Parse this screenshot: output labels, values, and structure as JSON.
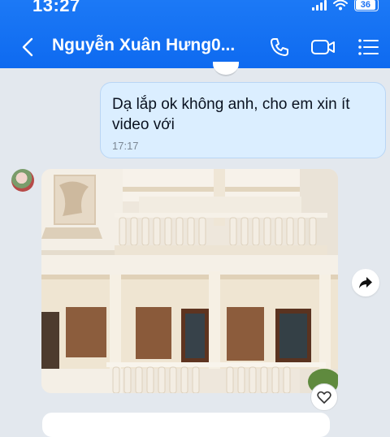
{
  "status_bar": {
    "time": "13:27",
    "battery_level": "36"
  },
  "header": {
    "contact_name": "Nguyễn Xuân Hưng0...",
    "accent_color": "#1473f5"
  },
  "messages": [
    {
      "text": "Dạ lắp ok không anh, cho em xin ít video với",
      "time": "17:17",
      "direction": "outgoing"
    }
  ],
  "icons": {
    "back": "chevron-left-icon",
    "call": "phone-icon",
    "video": "video-camera-icon",
    "menu": "list-menu-icon",
    "share": "share-arrow-icon",
    "reaction": "heart-icon"
  }
}
